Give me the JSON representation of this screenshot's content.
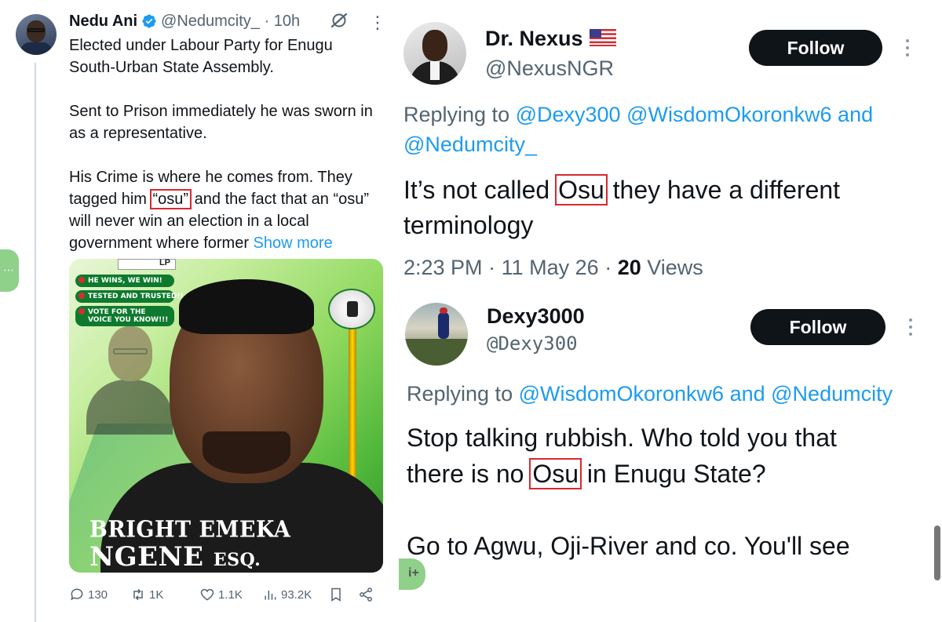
{
  "left_post": {
    "author_name": "Nedu Ani",
    "handle": "@Nedumcity_",
    "separator": "·",
    "time": "10h",
    "paragraphs": [
      "Elected under Labour Party for Enugu South-Urban State Assembly.",
      "Sent to Prison immediately he was sworn in as a representative."
    ],
    "p3_before": "His Crime is where he comes from. They tagged him ",
    "p3_highlight": "“osu”",
    "p3_after": " and the fact that an “osu” will never win an election in a local government where former ",
    "show_more": "Show more",
    "poster": {
      "party_logo_text": "LP",
      "slogans": [
        "HE WINS, WE WIN!",
        "TESTED AND TRUSTED!!",
        "VOTE FOR THE VOICE YOU KNOW!!!"
      ],
      "name_line1": "BRIGHT EMEKA",
      "name_line2": "NGENE",
      "name_suffix": "ESQ."
    },
    "actions": {
      "replies": "130",
      "reposts": "1K",
      "likes": "1.1K",
      "views": "93.2K"
    },
    "side_tab_glyph": "⋯"
  },
  "right_reply1": {
    "author_name": "Dr. Nexus",
    "handle": "@NexusNGR",
    "follow_label": "Follow",
    "replying_prefix": "Replying to ",
    "replying_line1_mentions": "@Dexy300 @WisdomOkoronkw6",
    "replying_and": " and",
    "replying_line2_mention": "@Nedumcity_",
    "text_line1_before": "It’s not called ",
    "text_line1_highlight": "Osu",
    "text_line1_after": " they have a different",
    "text_line2": "terminology",
    "time": "2:23 PM",
    "date": "11 May 26",
    "separator": "·",
    "views_count": "20",
    "views_label": "Views"
  },
  "right_reply2": {
    "author_name": "Dexy3000",
    "handle": "@Dexy300",
    "follow_label": "Follow",
    "replying_prefix": "Replying to ",
    "replying_mention1": "@WisdomOkoronkw6",
    "replying_and": " and ",
    "replying_mention2": "@Nedumcity",
    "text_line1": "Stop talking rubbish. Who told you that",
    "text_line2_before": "there is no ",
    "text_line2_highlight": "Osu",
    "text_line2_after": " in Enugu State?",
    "text_line3": "Go to Agwu, Oji-River and co. You'll see"
  },
  "float_tab_glyph": "i+",
  "colors": {
    "link": "#1d9bf0",
    "muted": "#536471",
    "text": "#0f1419",
    "highlight_box": "#d9282f",
    "follow_bg": "#0f1419",
    "side_tab": "#8fd08a"
  }
}
